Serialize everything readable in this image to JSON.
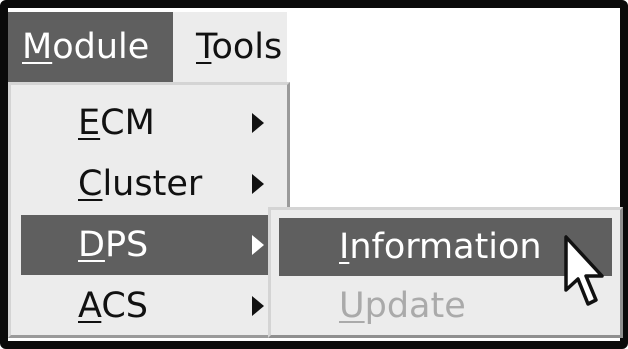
{
  "menubar": {
    "items": [
      {
        "mnemonic": "M",
        "rest": "odule",
        "selected": true
      },
      {
        "mnemonic": "T",
        "rest": "ools",
        "selected": false
      }
    ]
  },
  "module_menu": {
    "items": [
      {
        "mnemonic": "E",
        "rest": "CM",
        "has_submenu": true,
        "selected": false
      },
      {
        "mnemonic": "C",
        "rest": "luster",
        "has_submenu": true,
        "selected": false
      },
      {
        "mnemonic": "D",
        "rest": "PS",
        "has_submenu": true,
        "selected": true
      },
      {
        "mnemonic": "A",
        "rest": "CS",
        "has_submenu": true,
        "selected": false
      }
    ]
  },
  "dps_submenu": {
    "items": [
      {
        "mnemonic": "I",
        "rest": "nformation",
        "selected": true,
        "enabled": true
      },
      {
        "mnemonic": "U",
        "rest": "pdate",
        "selected": false,
        "enabled": false
      }
    ]
  },
  "icons": {
    "submenu_arrow": "triangle-right-icon",
    "cursor": "mouse-pointer-icon"
  },
  "colors": {
    "highlight": "#5f5f5f",
    "menu_background": "#ececec",
    "disabled_text": "#aaaaaa",
    "frame": "#0a0a0a"
  }
}
